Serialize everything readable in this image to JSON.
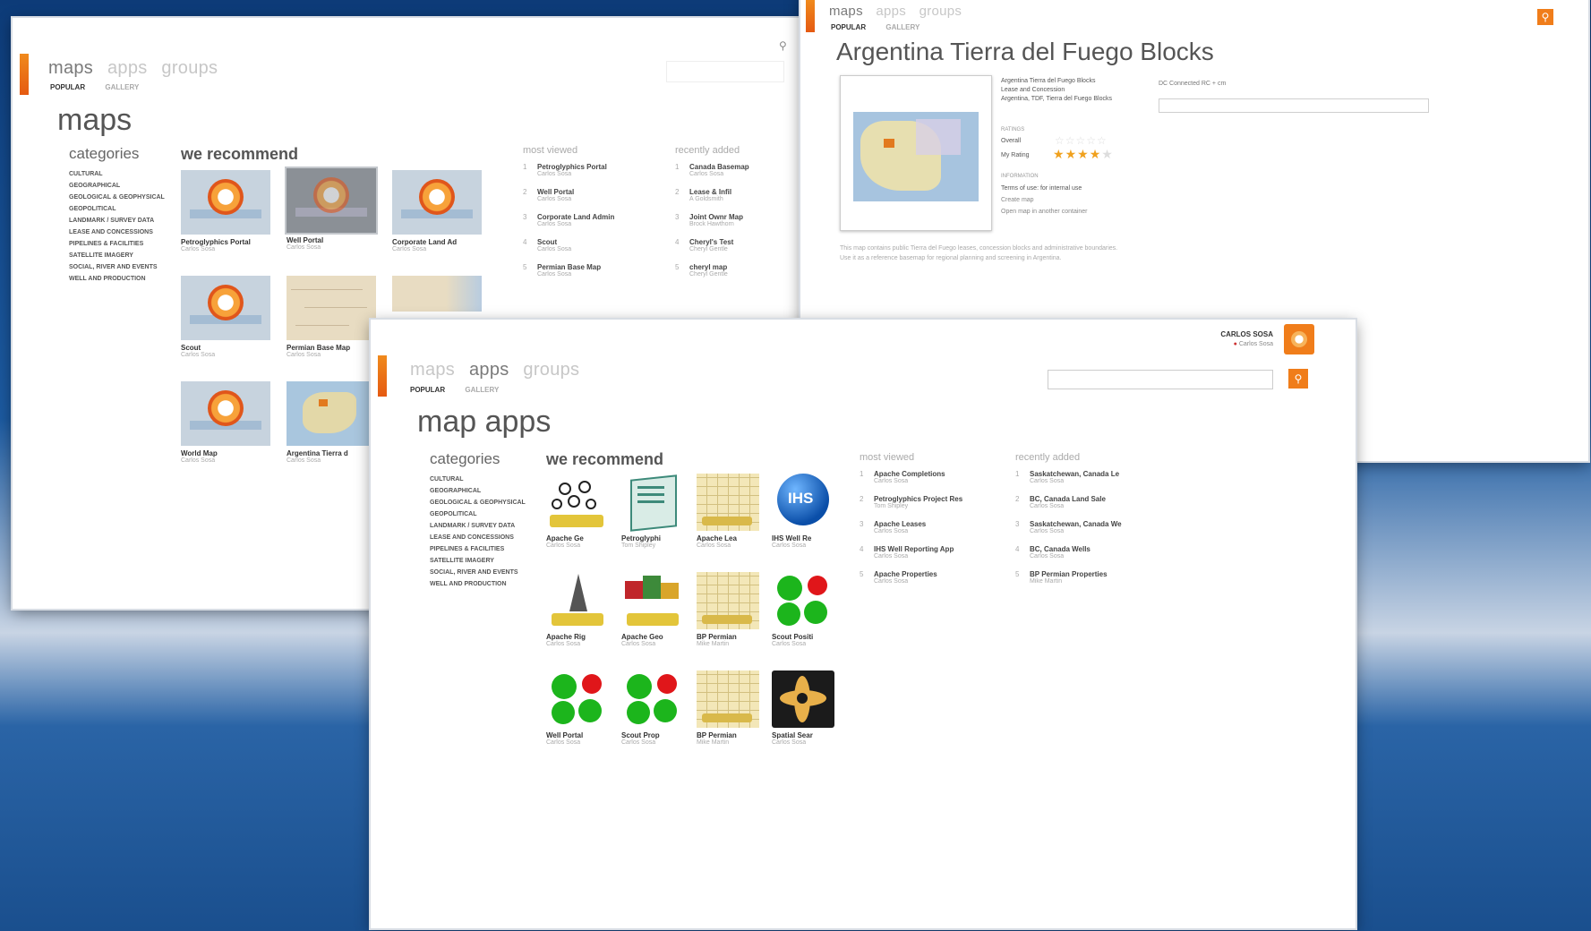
{
  "win_maps": {
    "nav": [
      "maps",
      "apps",
      "groups"
    ],
    "subnav": [
      "POPULAR",
      "GALLERY"
    ],
    "title": "maps",
    "categories_heading": "categories",
    "categories": [
      "CULTURAL",
      "GEOGRAPHICAL",
      "GEOLOGICAL & GEOPHYSICAL",
      "GEOPOLITICAL",
      "LANDMARK / SURVEY DATA",
      "LEASE AND CONCESSIONS",
      "PIPELINES & FACILITIES",
      "SATELLITE IMAGERY",
      "SOCIAL, RIVER AND EVENTS",
      "WELL AND PRODUCTION"
    ],
    "recommend_heading": "we recommend",
    "tiles": [
      {
        "label": "Petroglyphics Portal",
        "sub": "Carlos Sosa"
      },
      {
        "label": "Well Portal",
        "sub": "Carlos Sosa"
      },
      {
        "label": "Corporate Land Ad",
        "sub": "Carlos Sosa"
      },
      {
        "label": "Scout",
        "sub": "Carlos Sosa"
      },
      {
        "label": "Permian Base Map",
        "sub": "Carlos Sosa"
      },
      {
        "label": "",
        "sub": ""
      },
      {
        "label": "World Map",
        "sub": "Carlos Sosa"
      },
      {
        "label": "Argentina Tierra d",
        "sub": "Carlos Sosa"
      }
    ],
    "most_viewed_heading": "most viewed",
    "most_viewed": [
      {
        "t": "Petroglyphics Portal",
        "s": "Carlos Sosa"
      },
      {
        "t": "Well Portal",
        "s": "Carlos Sosa"
      },
      {
        "t": "Corporate Land Admin",
        "s": "Carlos Sosa"
      },
      {
        "t": "Scout",
        "s": "Carlos Sosa"
      },
      {
        "t": "Permian Base Map",
        "s": "Carlos Sosa"
      }
    ],
    "recently_added_heading": "recently added",
    "recently_added": [
      {
        "t": "Canada Basemap",
        "s": "Carlos Sosa"
      },
      {
        "t": "Lease & Infil",
        "s": "A Goldsmith"
      },
      {
        "t": "Joint Ownr Map",
        "s": "Brock Hawthorn"
      },
      {
        "t": "Cheryl's Test",
        "s": "Cheryl Gentle"
      },
      {
        "t": "cheryl map",
        "s": "Cheryl Gentle"
      }
    ]
  },
  "win_detail": {
    "nav": [
      "maps",
      "apps",
      "groups"
    ],
    "subnav": [
      "POPULAR",
      "GALLERY"
    ],
    "title": "Argentina Tierra del Fuego Blocks",
    "meta_lines": [
      "Argentina Tierra del Fuego Blocks",
      "Lease and Concession",
      "Argentina, TDF, Tierra del Fuego Blocks"
    ],
    "ratings_label": "RATINGS",
    "overall_label": "Overall",
    "my_rating_label": "My Rating",
    "my_rating": 4,
    "rating_max": 5,
    "info_label": "INFORMATION",
    "info_lines": [
      "Terms of use: for internal use",
      "Create map",
      "Open map in another container"
    ],
    "side_label": "DC Connected RC + cm",
    "description": "This map contains public Tierra del Fuego leases, concession blocks and administrative boundaries. Use it as a reference basemap for regional planning and screening in Argentina."
  },
  "win_apps": {
    "user_name": "CARLOS SOSA",
    "user_sub": "Carlos Sosa",
    "nav": [
      "maps",
      "apps",
      "groups"
    ],
    "subnav": [
      "POPULAR",
      "GALLERY"
    ],
    "title": "map apps",
    "categories_heading": "categories",
    "categories": [
      "CULTURAL",
      "GEOGRAPHICAL",
      "GEOLOGICAL & GEOPHYSICAL",
      "GEOPOLITICAL",
      "LANDMARK / SURVEY DATA",
      "LEASE AND CONCESSIONS",
      "PIPELINES & FACILITIES",
      "SATELLITE IMAGERY",
      "SOCIAL, RIVER AND EVENTS",
      "WELL AND PRODUCTION"
    ],
    "recommend_heading": "we recommend",
    "apps": [
      {
        "label": "Apache Ge",
        "sub": "Carlos Sosa",
        "icon": "network-icon"
      },
      {
        "label": "Petroglyphi",
        "sub": "Tom Shipley",
        "icon": "document-icon"
      },
      {
        "label": "Apache Lea",
        "sub": "Carlos Sosa",
        "icon": "grid-map-icon"
      },
      {
        "label": "IHS Well Re",
        "sub": "Carlos Sosa",
        "icon": "ihs-globe-icon"
      },
      {
        "label": "Apache Rig",
        "sub": "Carlos Sosa",
        "icon": "rig-icon"
      },
      {
        "label": "Apache Geo",
        "sub": "Carlos Sosa",
        "icon": "blocks-icon"
      },
      {
        "label": "BP Permian",
        "sub": "Mike Martin",
        "icon": "grid-map-icon"
      },
      {
        "label": "Scout Positi",
        "sub": "Carlos Sosa",
        "icon": "circles-icon"
      },
      {
        "label": "Well Portal",
        "sub": "Carlos Sosa",
        "icon": "circles-icon"
      },
      {
        "label": "Scout Prop",
        "sub": "Carlos Sosa",
        "icon": "circles-icon"
      },
      {
        "label": "BP Permian",
        "sub": "Mike Martin",
        "icon": "grid-map-icon"
      },
      {
        "label": "Spatial Sear",
        "sub": "Carlos Sosa",
        "icon": "cross-icon"
      }
    ],
    "most_viewed_heading": "most viewed",
    "most_viewed": [
      {
        "t": "Apache Completions",
        "s": "Carlos Sosa"
      },
      {
        "t": "Petroglyphics Project Res",
        "s": "Tom Shipley"
      },
      {
        "t": "Apache Leases",
        "s": "Carlos Sosa"
      },
      {
        "t": "IHS Well Reporting App",
        "s": "Carlos Sosa"
      },
      {
        "t": "Apache Properties",
        "s": "Carlos Sosa"
      }
    ],
    "recently_added_heading": "recently added",
    "recently_added": [
      {
        "t": "Saskatchewan, Canada Le",
        "s": "Carlos Sosa"
      },
      {
        "t": "BC, Canada Land Sale",
        "s": "Carlos Sosa"
      },
      {
        "t": "Saskatchewan, Canada We",
        "s": "Carlos Sosa"
      },
      {
        "t": "BC, Canada Wells",
        "s": "Carlos Sosa"
      },
      {
        "t": "BP Permian Properties",
        "s": "Mike Martin"
      }
    ],
    "search_placeholder": ""
  },
  "colors": {
    "accent": "#f07d1a",
    "link": "#333333"
  }
}
